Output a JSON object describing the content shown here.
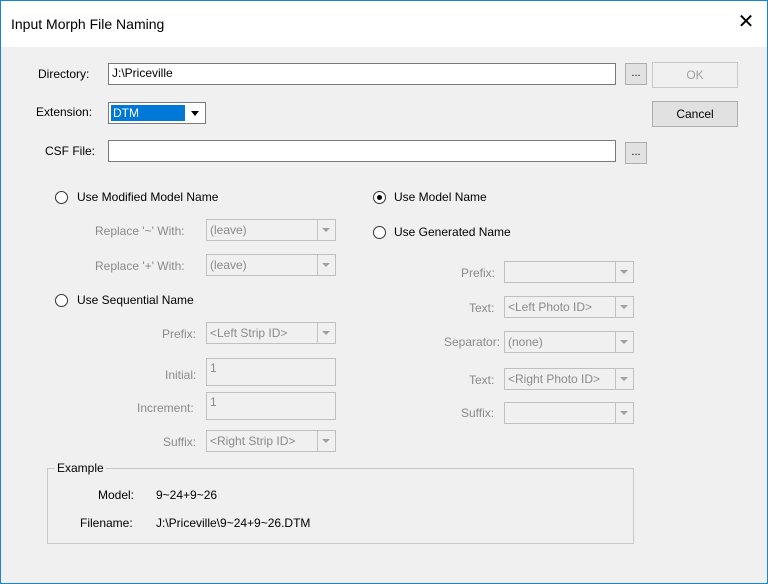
{
  "window": {
    "title": "Input Morph File Naming",
    "close_glyph": "✕"
  },
  "directory": {
    "label": "Directory:",
    "value": "J:\\Priceville",
    "browse": "..."
  },
  "extension": {
    "label": "Extension:",
    "value": "DTM"
  },
  "csf": {
    "label": "CSF File:",
    "value": "",
    "browse": "..."
  },
  "buttons": {
    "ok": "OK",
    "cancel": "Cancel"
  },
  "modified": {
    "label": "Use Modified Model Name",
    "replace_tilde_label": "Replace '~' With:",
    "replace_tilde_value": "(leave)",
    "replace_plus_label": "Replace '+' With:",
    "replace_plus_value": "(leave)"
  },
  "sequential": {
    "label": "Use Sequential Name",
    "prefix_label": "Prefix:",
    "prefix_value": "<Left Strip ID>",
    "initial_label": "Initial:",
    "initial_value": "1",
    "increment_label": "Increment:",
    "increment_value": "1",
    "suffix_label": "Suffix:",
    "suffix_value": "<Right Strip ID>"
  },
  "model_name": {
    "label": "Use Model Name",
    "selected": true
  },
  "generated": {
    "label": "Use Generated Name",
    "prefix_label": "Prefix:",
    "prefix_value": "",
    "text1_label": "Text:",
    "text1_value": "<Left Photo ID>",
    "separator_label": "Separator:",
    "separator_value": "(none)",
    "text2_label": "Text:",
    "text2_value": "<Right Photo ID>",
    "suffix_label": "Suffix:",
    "suffix_value": ""
  },
  "example": {
    "title": "Example",
    "model_label": "Model:",
    "model_value": "9~24+9~26",
    "filename_label": "Filename:",
    "filename_value": "J:\\Priceville\\9~24+9~26.DTM"
  },
  "colors": {
    "accent": "#0078d7",
    "window_border": "#1883d7"
  }
}
